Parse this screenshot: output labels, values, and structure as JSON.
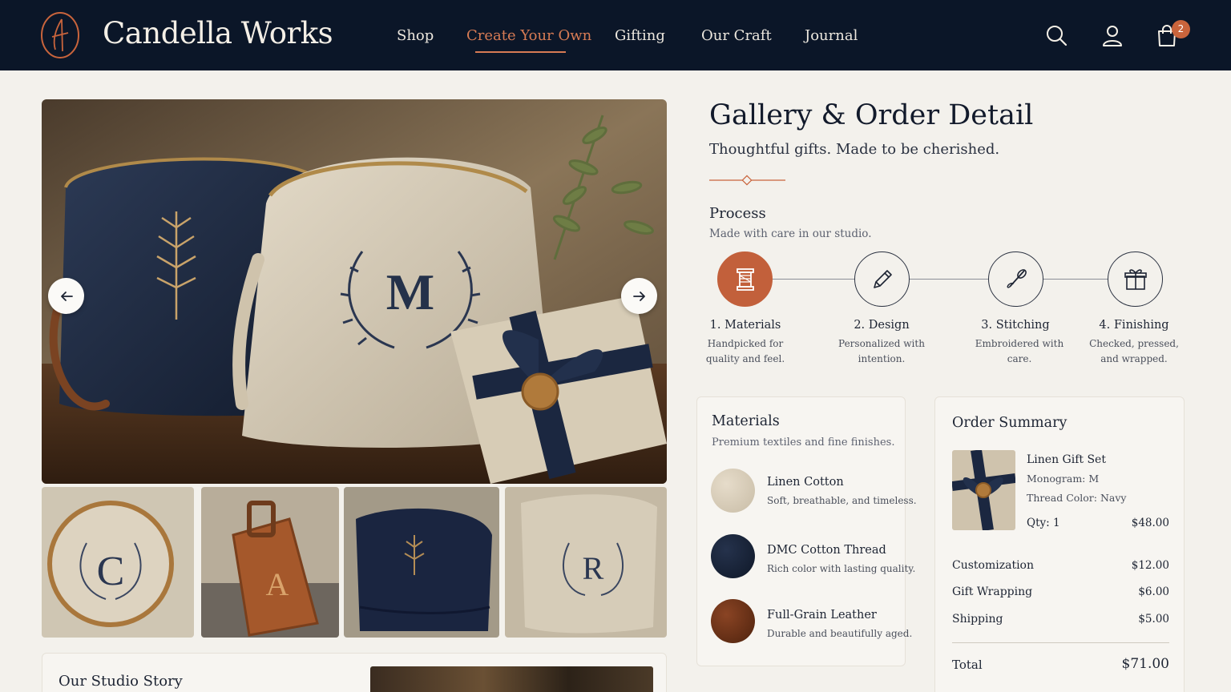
{
  "header": {
    "brand": "Candella Works",
    "nav": [
      "Shop",
      "Create Your Own",
      "Gifting",
      "Our Craft",
      "Journal"
    ],
    "active_nav": "Create Your Own",
    "cart_count": "2"
  },
  "gallery": {
    "hero_monogram": "M",
    "thumb_letters": [
      "C",
      "A",
      "",
      "R"
    ]
  },
  "story": {
    "title": "Our Studio Story"
  },
  "detail": {
    "title": "Gallery & Order Detail",
    "subtitle": "Thoughtful gifts. Made to be cherished."
  },
  "process": {
    "title": "Process",
    "subtitle": "Made with care in our studio.",
    "steps": [
      {
        "label": "1. Materials",
        "desc": "Handpicked for quality and feel.",
        "icon": "thread-spool-icon"
      },
      {
        "label": "2. Design",
        "desc": "Personalized with intention.",
        "icon": "pencil-icon"
      },
      {
        "label": "3. Stitching",
        "desc": "Embroidered with care.",
        "icon": "needle-icon"
      },
      {
        "label": "4. Finishing",
        "desc": "Checked, pressed, and wrapped.",
        "icon": "gift-icon"
      }
    ]
  },
  "materials": {
    "title": "Materials",
    "subtitle": "Premium textiles and fine finishes.",
    "items": [
      {
        "name": "Linen Cotton",
        "desc": "Soft, breathable, and timeless.",
        "color": "#d8cdb9"
      },
      {
        "name": "DMC Cotton Thread",
        "desc": "Rich color with lasting quality.",
        "color": "#18243a"
      },
      {
        "name": "Full-Grain Leather",
        "desc": "Durable and beautifully aged.",
        "color": "#6e341a"
      }
    ]
  },
  "order": {
    "title": "Order Summary",
    "product_name": "Linen Gift Set",
    "monogram": "Monogram: M",
    "thread_color": "Thread Color: Navy",
    "qty": "Qty: 1",
    "item_price": "$48.00",
    "lines": [
      {
        "label": "Customization",
        "value": "$12.00"
      },
      {
        "label": "Gift Wrapping",
        "value": "$6.00"
      },
      {
        "label": "Shipping",
        "value": "$5.00"
      }
    ],
    "total_label": "Total",
    "total_value": "$71.00"
  },
  "colors": {
    "navy": "#0b1628",
    "accent": "#c9643c",
    "background": "#f3f1ec"
  }
}
